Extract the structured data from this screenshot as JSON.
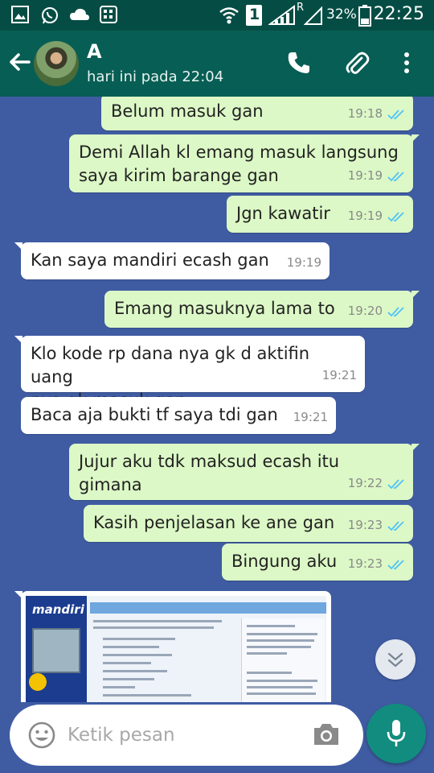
{
  "status_bar": {
    "sim_indicator": "1",
    "roaming_indicator": "R",
    "battery": "32%",
    "time": "22:25",
    "icons": [
      "gallery-icon",
      "whatsapp-icon",
      "cloud-icon",
      "bbm-icon",
      "wifi-icon",
      "signal-icon",
      "battery-icon"
    ]
  },
  "header": {
    "contact_name": "A",
    "last_seen": "hari ini pada 22:04",
    "icons": [
      "back-arrow-icon",
      "phone-icon",
      "paperclip-icon",
      "more-vert-icon"
    ]
  },
  "messages": [
    {
      "direction": "out",
      "lines": [
        "Belum masuk gan"
      ],
      "time": "19:18",
      "read": true
    },
    {
      "direction": "out",
      "lines": [
        "Demi Allah kl emang masuk langsung",
        "saya kirim barange gan"
      ],
      "time": "19:19",
      "read": true
    },
    {
      "direction": "out",
      "lines": [
        "Jgn kawatir"
      ],
      "time": "19:19",
      "read": true
    },
    {
      "direction": "in",
      "lines": [
        "Kan saya mandiri ecash gan"
      ],
      "time": "19:19"
    },
    {
      "direction": "out",
      "lines": [
        "Emang masuknya lama to"
      ],
      "time": "19:20",
      "read": true
    },
    {
      "direction": "in",
      "lines": [
        "Klo kode rp dana nya gk d aktifin uang",
        "nya gk masuk gan"
      ],
      "time": "19:21"
    },
    {
      "direction": "in",
      "lines": [
        "Baca aja bukti tf saya tdi gan"
      ],
      "time": "19:21"
    },
    {
      "direction": "out",
      "lines": [
        "Jujur aku tdk maksud ecash itu",
        "gimana"
      ],
      "time": "19:22",
      "read": true
    },
    {
      "direction": "out",
      "lines": [
        "Kasih penjelasan ke ane gan"
      ],
      "time": "19:23",
      "read": true
    },
    {
      "direction": "out",
      "lines": [
        "Bingung aku"
      ],
      "time": "19:23",
      "read": true
    }
  ],
  "image_message": {
    "logo_text": "mandiri"
  },
  "composer": {
    "placeholder": "Ketik pesan"
  },
  "colors": {
    "app_bar": "#075e54",
    "status_bar": "#054d44",
    "outgoing_bubble": "#dcf8c6",
    "incoming_bubble": "#ffffff",
    "chat_background": "#3f5ca3",
    "read_ticks": "#4fc3f7",
    "fab": "#128c7e"
  }
}
